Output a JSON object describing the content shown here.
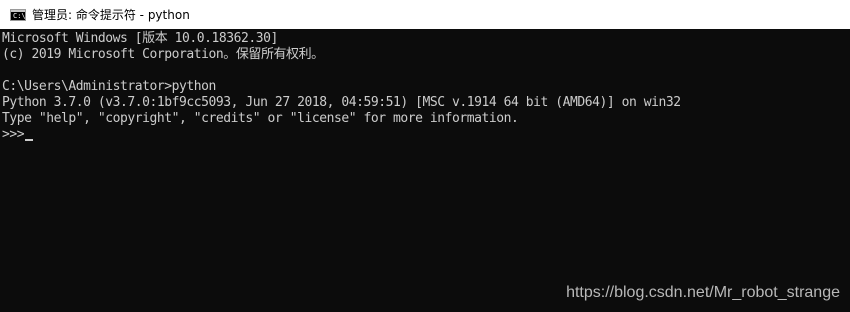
{
  "window": {
    "title": "管理员: 命令提示符 - python",
    "icon": "cmd-console-icon",
    "icon_glyph": "C:\\"
  },
  "console": {
    "lines": [
      "Microsoft Windows [版本 10.0.18362.30]",
      "(c) 2019 Microsoft Corporation。保留所有权利。",
      "",
      "C:\\Users\\Administrator>python",
      "Python 3.7.0 (v3.7.0:1bf9cc5093, Jun 27 2018, 04:59:51) [MSC v.1914 64 bit (AMD64)] on win32",
      "Type \"help\", \"copyright\", \"credits\" or \"license\" for more information.",
      ">>>"
    ],
    "background": "#0c0c0c",
    "foreground": "#cccccc"
  },
  "watermark": "https://blog.csdn.net/Mr_robot_strange"
}
